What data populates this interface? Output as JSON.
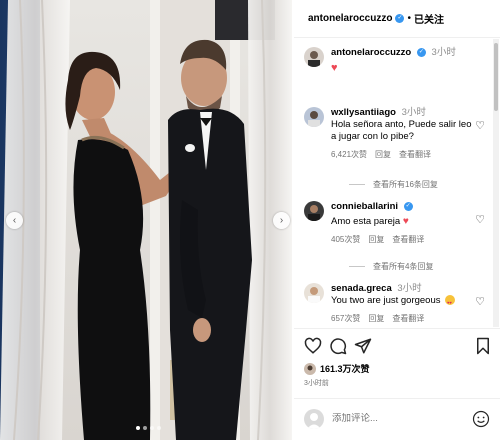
{
  "colors": {
    "accent": "#3897f0",
    "like_red": "#ed4956",
    "text_muted": "#737373"
  },
  "header": {
    "username": "antonelaroccuzzo",
    "separator": "•",
    "follow_label": "已关注"
  },
  "caption": {
    "username": "antonelaroccuzzo",
    "time": "3小时",
    "text_icon": "red-heart-emoji"
  },
  "comments": [
    {
      "username": "wxllysantiiago",
      "time": "3小时",
      "text_line1": "Hola señora anto, Puede salir leo",
      "text_line2": "a jugar con lo pibe?",
      "likes": "6,421次赞",
      "reply": "回复",
      "translate": "查看翻译",
      "view_replies": "查看所有16条回复"
    },
    {
      "username": "connieballarini",
      "time": "3小时",
      "text_line1": "Amo esta pareja",
      "likes": "405次赞",
      "reply": "回复",
      "translate": "查看翻译",
      "view_replies": "查看所有4条回复"
    },
    {
      "username": "senada.greca",
      "time": "3小时",
      "text_line1": "You two are just gorgeous",
      "likes": "657次赞",
      "reply": "回复",
      "translate": "查看翻译"
    }
  ],
  "post": {
    "likes_count": "161.3万次赞",
    "posted": "3小时前"
  },
  "add_comment": {
    "placeholder": "添加评论..."
  },
  "carousel": {
    "total_slides": 4,
    "active_index": 0
  }
}
